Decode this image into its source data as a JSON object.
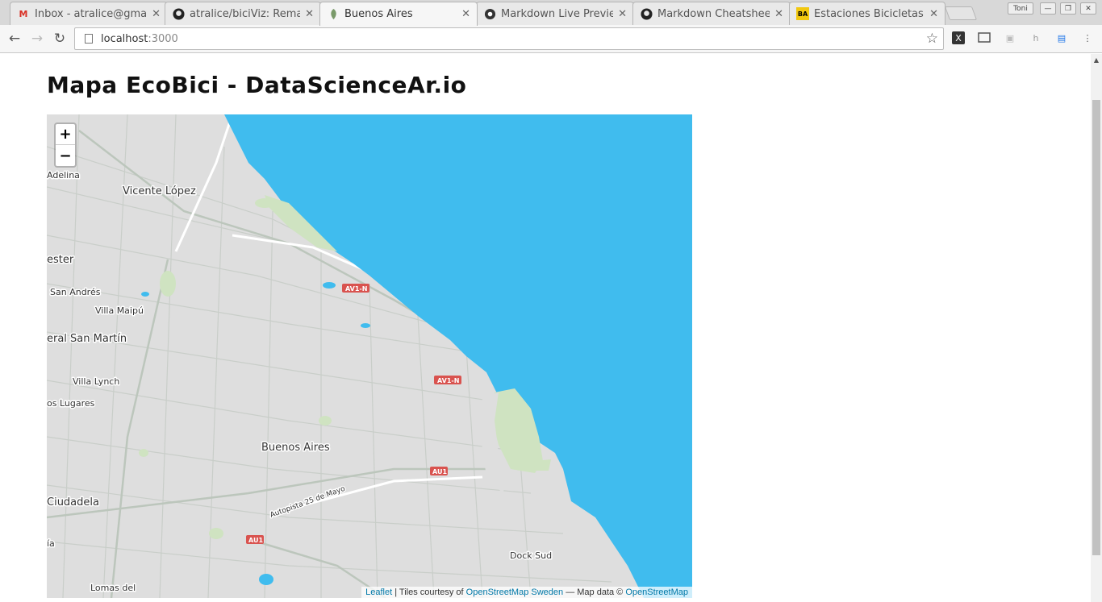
{
  "browser": {
    "tabs": [
      {
        "favicon": "gmail-icon",
        "title": "Inbox - atralice@gmail",
        "active": false
      },
      {
        "favicon": "github-icon",
        "title": "atralice/biciViz: Remake",
        "active": false
      },
      {
        "favicon": "leaflet-icon",
        "title": "Buenos Aires",
        "active": true
      },
      {
        "favicon": "markdown-live-icon",
        "title": "Markdown Live Preview",
        "active": false
      },
      {
        "favicon": "github-icon",
        "title": "Markdown Cheatsheet",
        "active": false
      },
      {
        "favicon": "ba-icon",
        "title": "Estaciones Bicicletas P",
        "active": false
      }
    ],
    "profile_button": "Toni",
    "address": {
      "host": "localhost",
      "port": ":3000"
    }
  },
  "page": {
    "title": "Mapa EcoBici - DataScienceAr.io"
  },
  "map": {
    "zoom_in": "+",
    "zoom_out": "−",
    "labels": {
      "adelina": "Adelina",
      "vicente_lopez": "Vicente López",
      "chester": "ester",
      "san_andres": "San Andrés",
      "villa_maipu": "Villa Maipú",
      "san_martin": "eral San Martín",
      "villa_lynch": "Villa Lynch",
      "los_lugares": "os Lugares",
      "buenos_aires": "Buenos Aires",
      "ciudadela": "Ciudadela",
      "ia": "ía",
      "lomas": "Lomas del",
      "dock_sud": "Dock Sud",
      "autopista": "Autopista 25 de Mayo"
    },
    "shields": {
      "av1n_top": "AV1-N",
      "av1n_mid": "AV1-N",
      "au1_right": "AU1",
      "au1_left": "AU1"
    },
    "attribution": {
      "leaflet": "Leaflet",
      "sep1": " | Tiles courtesy of ",
      "osm_sweden": "OpenStreetMap Sweden",
      "sep2": " — Map data © ",
      "osm": "OpenStreetMap"
    },
    "colors": {
      "water": "#40bcee",
      "land": "#dedede",
      "park": "#cfe3c1",
      "shield": "#d9534f"
    }
  }
}
